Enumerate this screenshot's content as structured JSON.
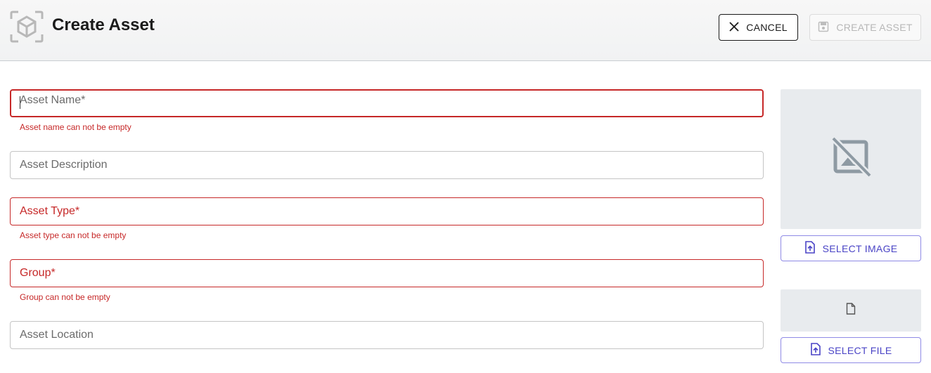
{
  "header": {
    "title": "Create Asset",
    "icon": "asset-cube-icon",
    "cancel_label": "CANCEL",
    "create_label": "CREATE ASSET"
  },
  "form": {
    "asset_name": {
      "label": "Asset Name*",
      "value": "",
      "error": "Asset name can not be empty"
    },
    "asset_description": {
      "label": "Asset Description",
      "value": ""
    },
    "asset_type": {
      "label": "Asset Type*",
      "value": "",
      "error": "Asset type can not be empty"
    },
    "group": {
      "label": "Group*",
      "value": "",
      "error": "Group can not be empty"
    },
    "asset_location": {
      "label": "Asset Location",
      "value": ""
    }
  },
  "media": {
    "image_placeholder_icon": "image-not-supported-icon",
    "select_image_label": "SELECT IMAGE",
    "file_placeholder_icon": "file-icon",
    "select_file_label": "SELECT FILE"
  },
  "colors": {
    "error": "#c62828",
    "primary": "#4a44c6",
    "disabled": "#b7b7b7",
    "placeholder_bg": "#e8ebee"
  }
}
